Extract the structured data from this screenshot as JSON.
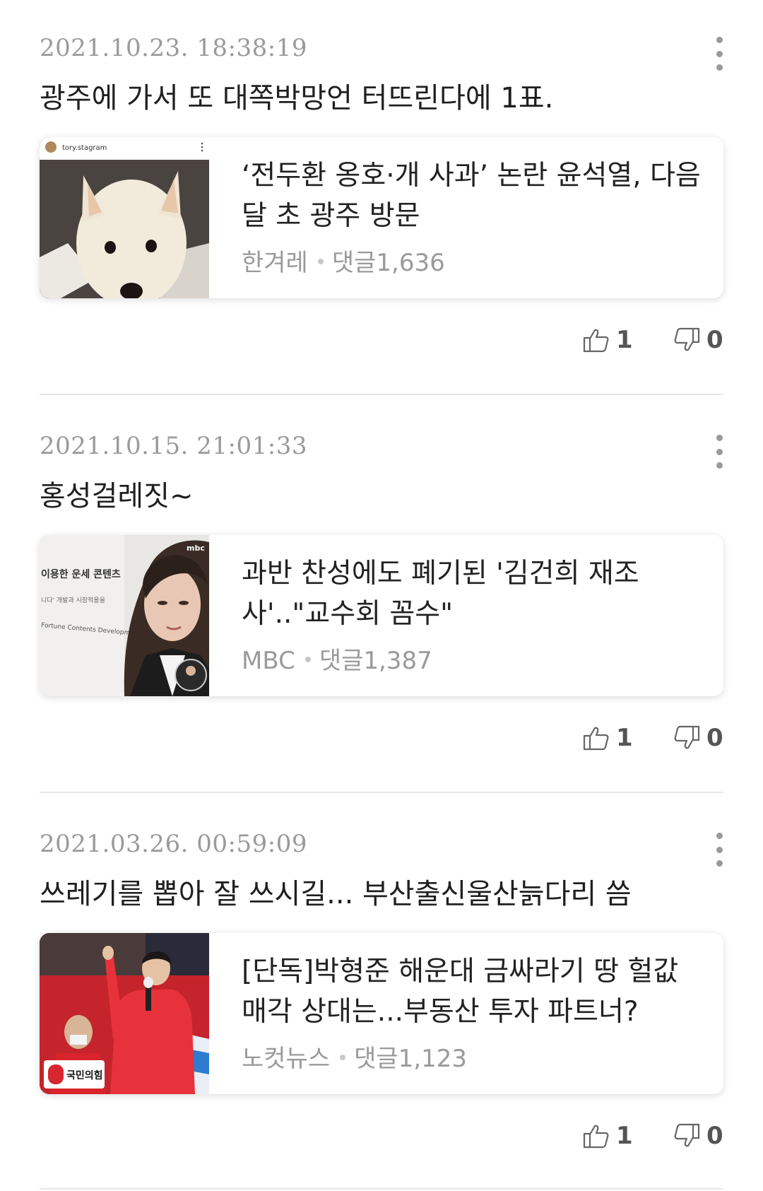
{
  "comments": [
    {
      "timestamp": "2021.10.23. 18:38:19",
      "text": "광주에 가서 또 대쪽박망언 터뜨린다에 1표.",
      "article": {
        "title": "‘전두환 옹호·개 사과’ 논란 윤석열, 다음 달 초 광주 방문",
        "source": "한겨레",
        "comments_label": "댓글1,636",
        "thumb_overlay_text": "tory.stagram"
      },
      "likes": "1",
      "dislikes": "0"
    },
    {
      "timestamp": "2021.10.15. 21:01:33",
      "text": "홍성걸레짓~",
      "article": {
        "title": "과반 찬성에도 폐기된 '김건희 재조사'..\"교수회 꼼수\"",
        "source": "MBC",
        "comments_label": "댓글1,387",
        "thumb_overlay_text": "이용한 운세 콘텐츠",
        "thumb_sub_text": "Fortune Contents Developm",
        "thumb_logo": "mbc"
      },
      "likes": "1",
      "dislikes": "0"
    },
    {
      "timestamp": "2021.03.26. 00:59:09",
      "text": "쓰레기를 뽑아 잘 쓰시길... 부산출신울산늙다리 씀",
      "article": {
        "title": "[단독]박형준 해운대 금싸라기 땅 헐값 매각 상대는...부동산 투자 파트너?",
        "source": "노컷뉴스",
        "comments_label": "댓글1,123",
        "thumb_overlay_text": "국민의힘"
      },
      "likes": "1",
      "dislikes": "0"
    }
  ],
  "colors": {
    "timestamp": "#9a9a9a",
    "text": "#1f1f1f",
    "meta": "#9a9a9a",
    "divider": "#e8e8e8",
    "campaign_red": "#d7262e"
  },
  "icons": {
    "more": "vertical-dots-icon",
    "like": "thumbs-up-outline-icon",
    "dislike": "thumbs-down-outline-icon"
  }
}
